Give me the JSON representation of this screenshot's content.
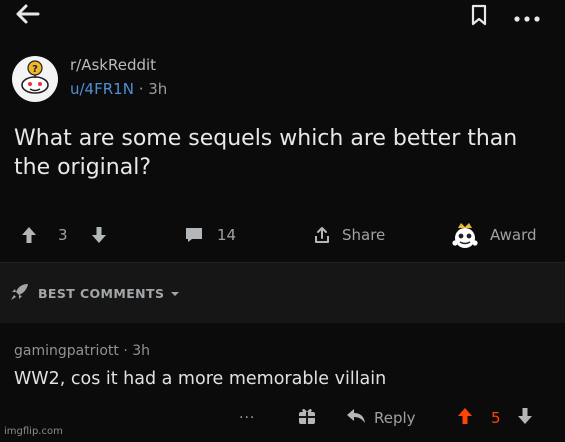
{
  "topbar": {
    "back_icon": "arrow-left-icon",
    "save_icon": "bookmark-icon",
    "more_icon": "more-horizontal-icon"
  },
  "post": {
    "subreddit": "r/AskReddit",
    "author": "u/4FR1N",
    "separator": " · ",
    "age": "3h",
    "title": "What are some sequels which are better than the original?",
    "upvotes": "3",
    "comments": "14",
    "share_label": "Share",
    "award_label": "Award"
  },
  "sort": {
    "label": "BEST COMMENTS"
  },
  "comment": {
    "author": "gamingpatriott",
    "separator": " · ",
    "age": "3h",
    "body": "WW2, cos it had a more memorable villain",
    "more_label": "···",
    "reply_label": "Reply",
    "score": "5"
  },
  "watermark": "imgflip.com",
  "colors": {
    "background": "#0b0b0b",
    "sort_bar": "#161616",
    "username": "#4f8fd6",
    "upvoted": "#ff4500",
    "muted_text": "#9ea1a4"
  }
}
